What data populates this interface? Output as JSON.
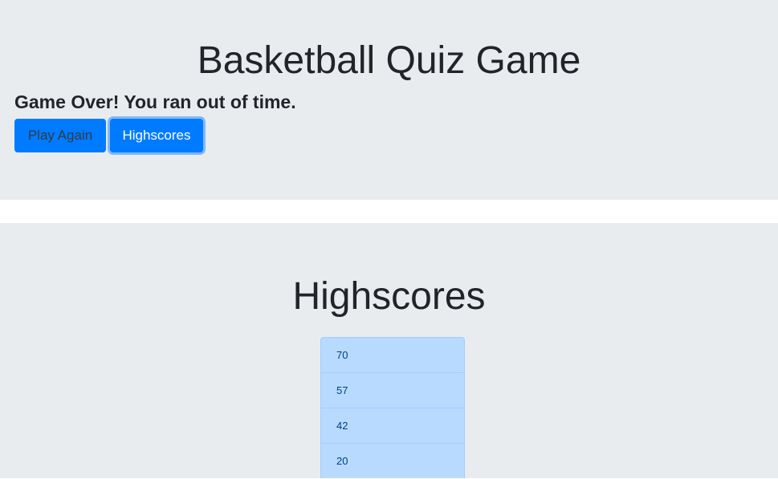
{
  "header": {
    "title": "Basketball Quiz Game",
    "message": "Game Over! You ran out of time."
  },
  "actions": {
    "play_again_label": "Play Again",
    "highscores_label": "Highscores"
  },
  "highscores": {
    "title": "Highscores",
    "scores": [
      "70",
      "57",
      "42",
      "20"
    ]
  },
  "colors": {
    "jumbotron_bg": "#e9ecef",
    "primary": "#007bff",
    "list_item_bg": "#b8daff",
    "list_item_text": "#004085"
  }
}
